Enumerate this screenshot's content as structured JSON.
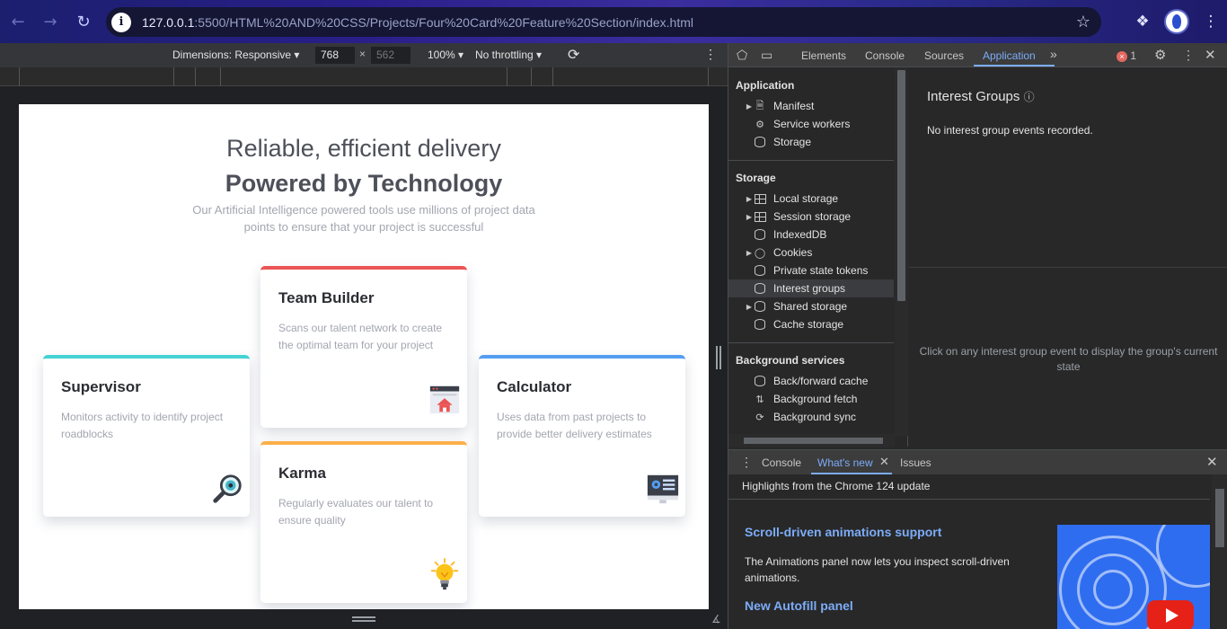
{
  "browser": {
    "url_host": "127.0.0.1",
    "url_rest": ":5500/HTML%20AND%20CSS/Projects/Four%20Card%20Feature%20Section/index.html"
  },
  "device_toolbar": {
    "dimensions_label": "Dimensions: Responsive",
    "width": "768",
    "height": "562",
    "zoom": "100%",
    "throttling": "No throttling"
  },
  "page": {
    "heading_light": "Reliable, efficient delivery",
    "heading_bold": "Powered by Technology",
    "subtitle": "Our Artificial Intelligence powered tools use millions of project data points to ensure that your project is successful",
    "cards": [
      {
        "title": "Supervisor",
        "text": "Monitors activity to identify project roadblocks",
        "accent": "#44d3d2"
      },
      {
        "title": "Team Builder",
        "text": "Scans our talent network to create the optimal team for your project",
        "accent": "#ea5454"
      },
      {
        "title": "Karma",
        "text": "Regularly evaluates our talent to ensure quality",
        "accent": "#fcaf4a"
      },
      {
        "title": "Calculator",
        "text": "Uses data from past projects to provide better delivery estimates",
        "accent": "#549ef2"
      }
    ]
  },
  "devtools": {
    "tabs": [
      "Elements",
      "Console",
      "Sources",
      "Application"
    ],
    "active_tab": "Application",
    "error_count": "1",
    "sidebar": {
      "application_header": "Application",
      "application_items": [
        "Manifest",
        "Service workers",
        "Storage"
      ],
      "storage_header": "Storage",
      "storage_items": [
        "Local storage",
        "Session storage",
        "IndexedDB",
        "Cookies",
        "Private state tokens",
        "Interest groups",
        "Shared storage",
        "Cache storage"
      ],
      "background_header": "Background services",
      "background_items": [
        "Back/forward cache",
        "Background fetch",
        "Background sync"
      ]
    },
    "main": {
      "title": "Interest Groups",
      "empty_message": "No interest group events recorded.",
      "hint": "Click on any interest group event to display the group's current state"
    },
    "drawer": {
      "tabs": [
        "Console",
        "What's new",
        "Issues"
      ],
      "highlights": "Highlights from the Chrome 124 update",
      "feature1_title": "Scroll-driven animations support",
      "feature1_text": "The Animations panel now lets you inspect scroll-driven animations.",
      "feature2_title": "New Autofill panel"
    }
  }
}
